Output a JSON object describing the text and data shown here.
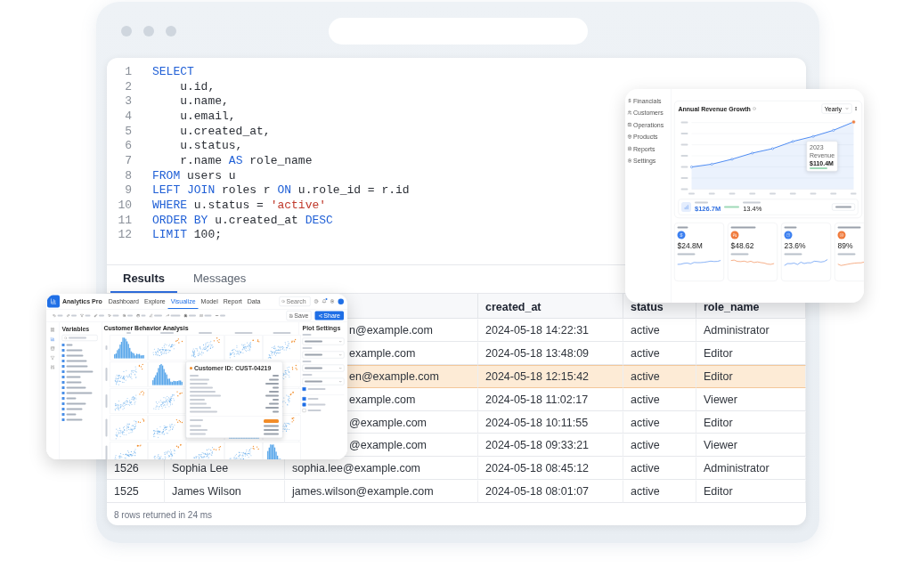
{
  "editor": {
    "lines": [
      {
        "number": "1",
        "tokens": [
          {
            "kind": "keyword",
            "text": "SELECT"
          }
        ]
      },
      {
        "number": "2",
        "tokens": [
          {
            "kind": "plain",
            "text": "    u.id,"
          }
        ]
      },
      {
        "number": "3",
        "tokens": [
          {
            "kind": "plain",
            "text": "    u.name,"
          }
        ]
      },
      {
        "number": "4",
        "tokens": [
          {
            "kind": "plain",
            "text": "    u.email,"
          }
        ]
      },
      {
        "number": "5",
        "tokens": [
          {
            "kind": "plain",
            "text": "    u.created_at,"
          }
        ]
      },
      {
        "number": "6",
        "tokens": [
          {
            "kind": "plain",
            "text": "    u.status,"
          }
        ]
      },
      {
        "number": "7",
        "tokens": [
          {
            "kind": "plain",
            "text": "    r.name "
          },
          {
            "kind": "keyword",
            "text": "AS"
          },
          {
            "kind": "plain",
            "text": " role_name"
          }
        ]
      },
      {
        "number": "8",
        "tokens": [
          {
            "kind": "keyword",
            "text": "FROM"
          },
          {
            "kind": "plain",
            "text": " users u"
          }
        ]
      },
      {
        "number": "9",
        "tokens": [
          {
            "kind": "keyword",
            "text": "LEFT JOIN"
          },
          {
            "kind": "plain",
            "text": " roles r "
          },
          {
            "kind": "keyword",
            "text": "ON"
          },
          {
            "kind": "plain",
            "text": " u.role_id = r.id"
          }
        ]
      },
      {
        "number": "10",
        "tokens": [
          {
            "kind": "keyword",
            "text": "WHERE"
          },
          {
            "kind": "plain",
            "text": " u.status = "
          },
          {
            "kind": "string",
            "text": "'active'"
          }
        ]
      },
      {
        "number": "11",
        "tokens": [
          {
            "kind": "keyword",
            "text": "ORDER BY"
          },
          {
            "kind": "plain",
            "text": " u.created_at "
          },
          {
            "kind": "keyword",
            "text": "DESC"
          }
        ]
      },
      {
        "number": "12",
        "tokens": [
          {
            "kind": "keyword",
            "text": "LIMIT"
          },
          {
            "kind": "plain",
            "text": " 100;"
          }
        ]
      }
    ]
  },
  "result_tabs": [
    {
      "label": "Results",
      "selected": true
    },
    {
      "label": "Messages",
      "selected": false
    }
  ],
  "table": {
    "visible_columns": [
      "created_at",
      "status",
      "role_name"
    ],
    "rows": [
      {
        "email": "n@example.com",
        "created_at": "2024-05-18 14:22:31",
        "status": "active",
        "role_name": "Administrator",
        "selected": false
      },
      {
        "email": "example.com",
        "created_at": "2024-05-18 13:48:09",
        "status": "active",
        "role_name": "Editor",
        "selected": false
      },
      {
        "email": "en@example.com",
        "created_at": "2024-05-18 12:15:42",
        "status": "active",
        "role_name": "Editor",
        "selected": true
      },
      {
        "email": "example.com",
        "created_at": "2024-05-18 11:02:17",
        "status": "active",
        "role_name": "Viewer",
        "selected": false
      },
      {
        "email": "@example.com",
        "created_at": "2024-05-18 10:11:55",
        "status": "active",
        "role_name": "Editor",
        "selected": false
      },
      {
        "email": "@example.com",
        "created_at": "2024-05-18 09:33:21",
        "status": "active",
        "role_name": "Viewer",
        "selected": false
      },
      {
        "id": "1526",
        "name": "Sophia Lee",
        "email": "sophia.lee@example.com",
        "created_at": "2024-05-18 08:45:12",
        "status": "active",
        "role_name": "Administrator",
        "selected": false
      },
      {
        "id": "1525",
        "name": "James Wilson",
        "email": "james.wilson@example.com",
        "created_at": "2024-05-18 08:01:07",
        "status": "active",
        "role_name": "Editor",
        "selected": false
      }
    ]
  },
  "status_text": "8 rows returned in 24 ms",
  "analytics_window": {
    "app_name": "Analytics Pro",
    "nav_tabs": [
      {
        "label": "Dashboard",
        "selected": false
      },
      {
        "label": "Explore",
        "selected": false
      },
      {
        "label": "Visualize",
        "selected": true
      },
      {
        "label": "Model",
        "selected": false
      },
      {
        "label": "Report",
        "selected": false
      },
      {
        "label": "Data",
        "selected": false
      }
    ],
    "search_placeholder": "Search",
    "save_label": "Save",
    "share_label": "Share",
    "variables_title": "Variables",
    "chart_title": "Customer Behavior Analysis",
    "tooltip_title": "Customer ID: CUST-04219",
    "settings": {
      "title": "Plot Settings",
      "show_correlation": {
        "checked": true
      },
      "options": [
        {
          "checked": true
        },
        {
          "checked": true
        },
        {
          "checked": false
        }
      ]
    }
  },
  "dashboard_window": {
    "sidebar": [
      {
        "label": "Financials"
      },
      {
        "label": "Customers"
      },
      {
        "label": "Operations"
      },
      {
        "label": "Products"
      },
      {
        "label": "Reports"
      },
      {
        "label": "Settings"
      }
    ],
    "chart_title": "Annual Revenue Growth",
    "period": "Yearly",
    "tooltip": {
      "year": "2023",
      "series": "Revenue",
      "value": "$110.4M"
    },
    "summary": {
      "revenue_value": "$126.7M",
      "cagr_value": "13.4%"
    },
    "kpis": [
      {
        "value": "$24.8M",
        "color": "#3b7ff0"
      },
      {
        "value": "$48.62",
        "color": "#f07a3b"
      },
      {
        "value": "23.6%",
        "color": "#3b7ff0"
      },
      {
        "value": "89%",
        "color": "#f07a3b"
      }
    ]
  }
}
